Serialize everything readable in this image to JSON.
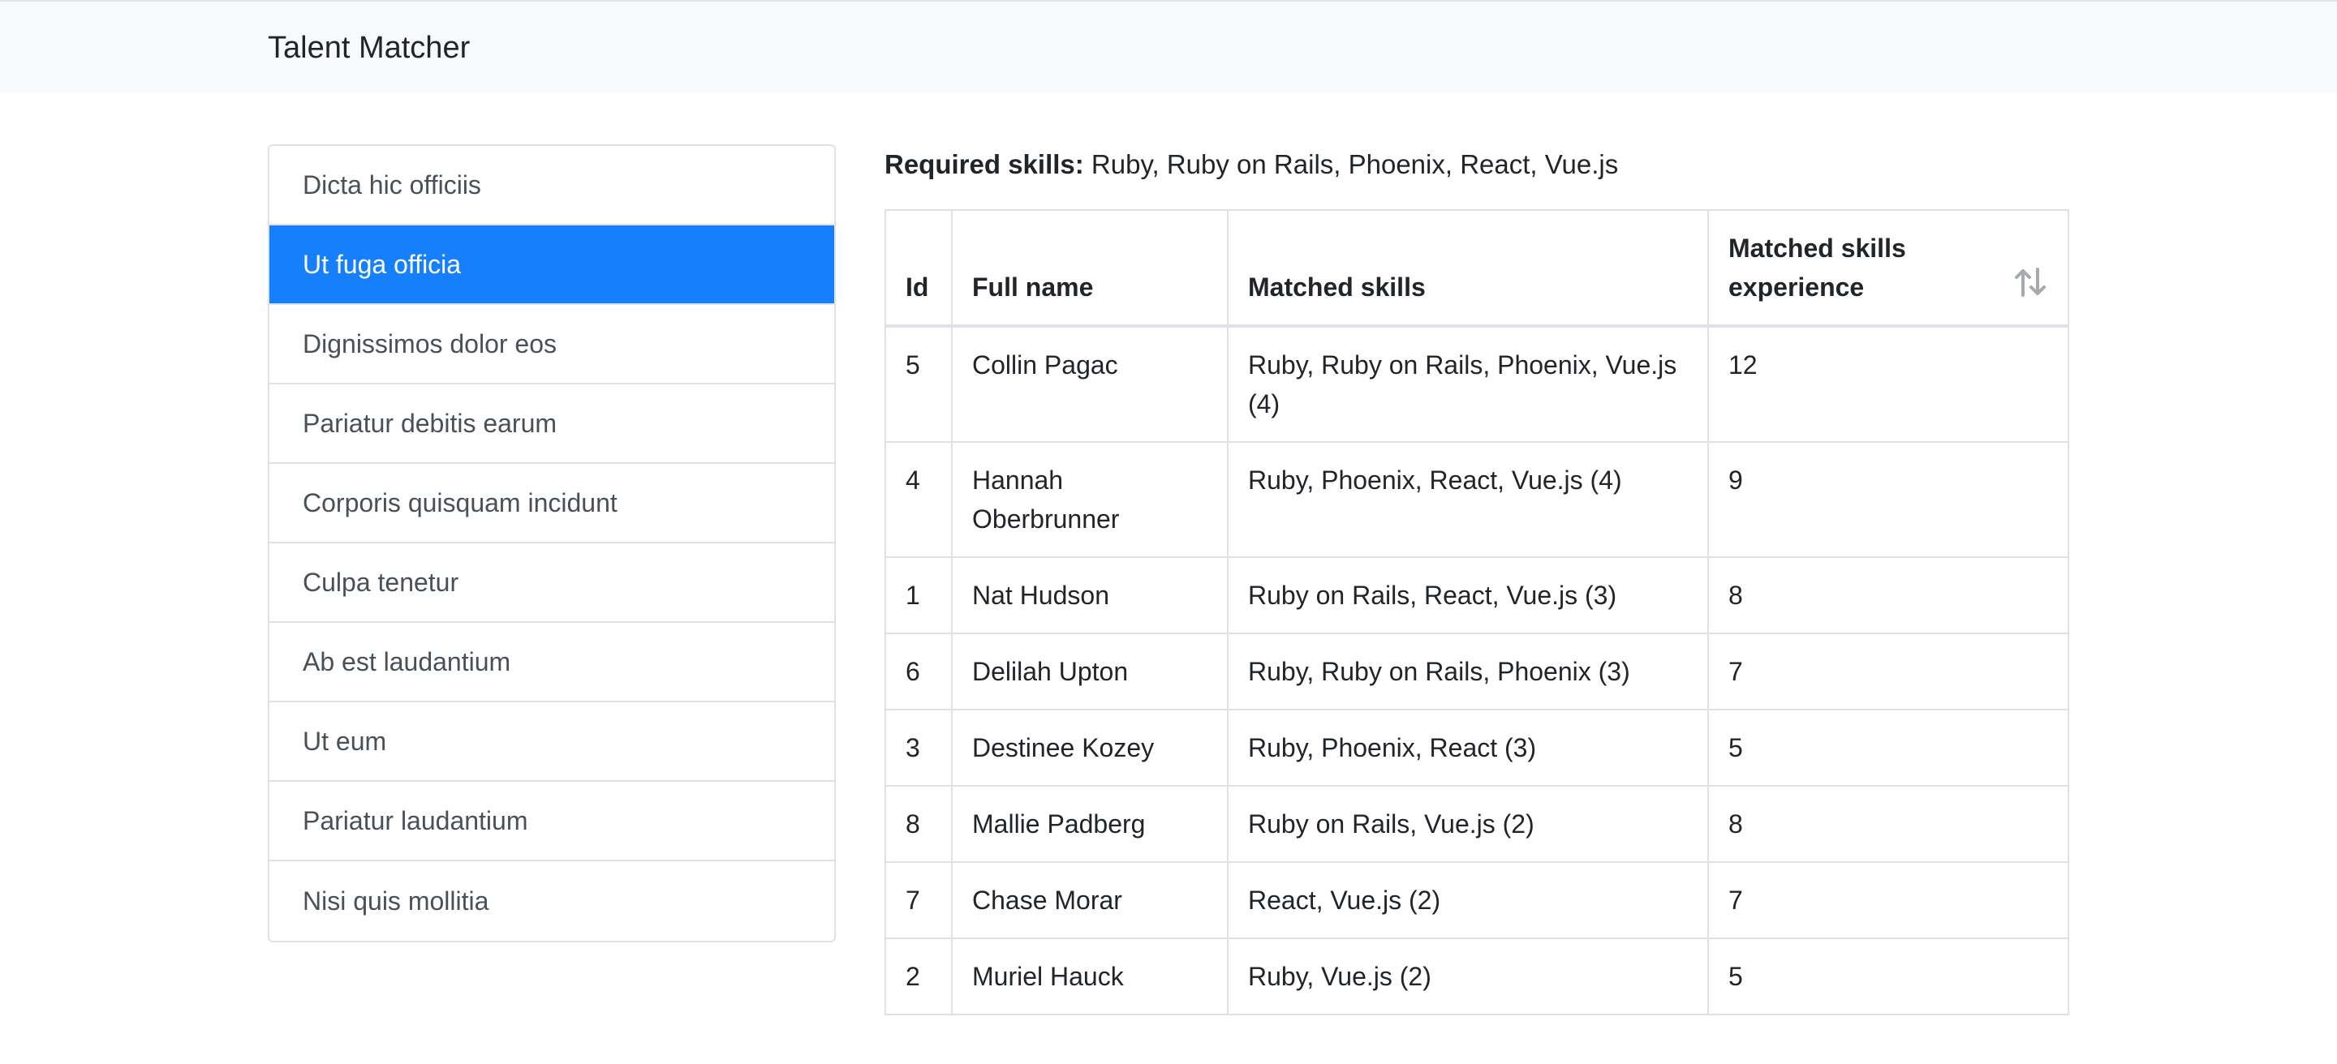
{
  "navbar": {
    "brand": "Talent Matcher"
  },
  "sidebar": {
    "items": [
      {
        "label": "Dicta hic officiis"
      },
      {
        "label": "Ut fuga officia",
        "active": true
      },
      {
        "label": "Dignissimos dolor eos"
      },
      {
        "label": "Pariatur debitis earum"
      },
      {
        "label": "Corporis quisquam incidunt"
      },
      {
        "label": "Culpa tenetur"
      },
      {
        "label": "Ab est laudantium"
      },
      {
        "label": "Ut eum"
      },
      {
        "label": "Pariatur laudantium"
      },
      {
        "label": "Nisi quis mollitia"
      }
    ],
    "active_color": "#167ffc"
  },
  "main": {
    "required_label": "Required skills:",
    "required_value": "Ruby, Ruby on Rails, Phoenix, React, Vue.js",
    "table": {
      "headers": {
        "id": "Id",
        "name": "Full name",
        "skills": "Matched skills",
        "experience": "Matched skills experience"
      },
      "sort_icon": "sort-arrows-icon",
      "rows": [
        {
          "id": "5",
          "name": "Collin Pagac",
          "skills": "Ruby, Ruby on Rails, Phoenix, Vue.js (4)",
          "experience": "12"
        },
        {
          "id": "4",
          "name": "Hannah Oberbrunner",
          "skills": "Ruby, Phoenix, React, Vue.js (4)",
          "experience": "9"
        },
        {
          "id": "1",
          "name": "Nat Hudson",
          "skills": "Ruby on Rails, React, Vue.js (3)",
          "experience": "8"
        },
        {
          "id": "6",
          "name": "Delilah Upton",
          "skills": "Ruby, Ruby on Rails, Phoenix (3)",
          "experience": "7"
        },
        {
          "id": "3",
          "name": "Destinee Kozey",
          "skills": "Ruby, Phoenix, React (3)",
          "experience": "5"
        },
        {
          "id": "8",
          "name": "Mallie Padberg",
          "skills": "Ruby on Rails, Vue.js (2)",
          "experience": "8"
        },
        {
          "id": "7",
          "name": "Chase Morar",
          "skills": "React, Vue.js (2)",
          "experience": "7"
        },
        {
          "id": "2",
          "name": "Muriel Hauck",
          "skills": "Ruby, Vue.js (2)",
          "experience": "5"
        }
      ]
    }
  }
}
